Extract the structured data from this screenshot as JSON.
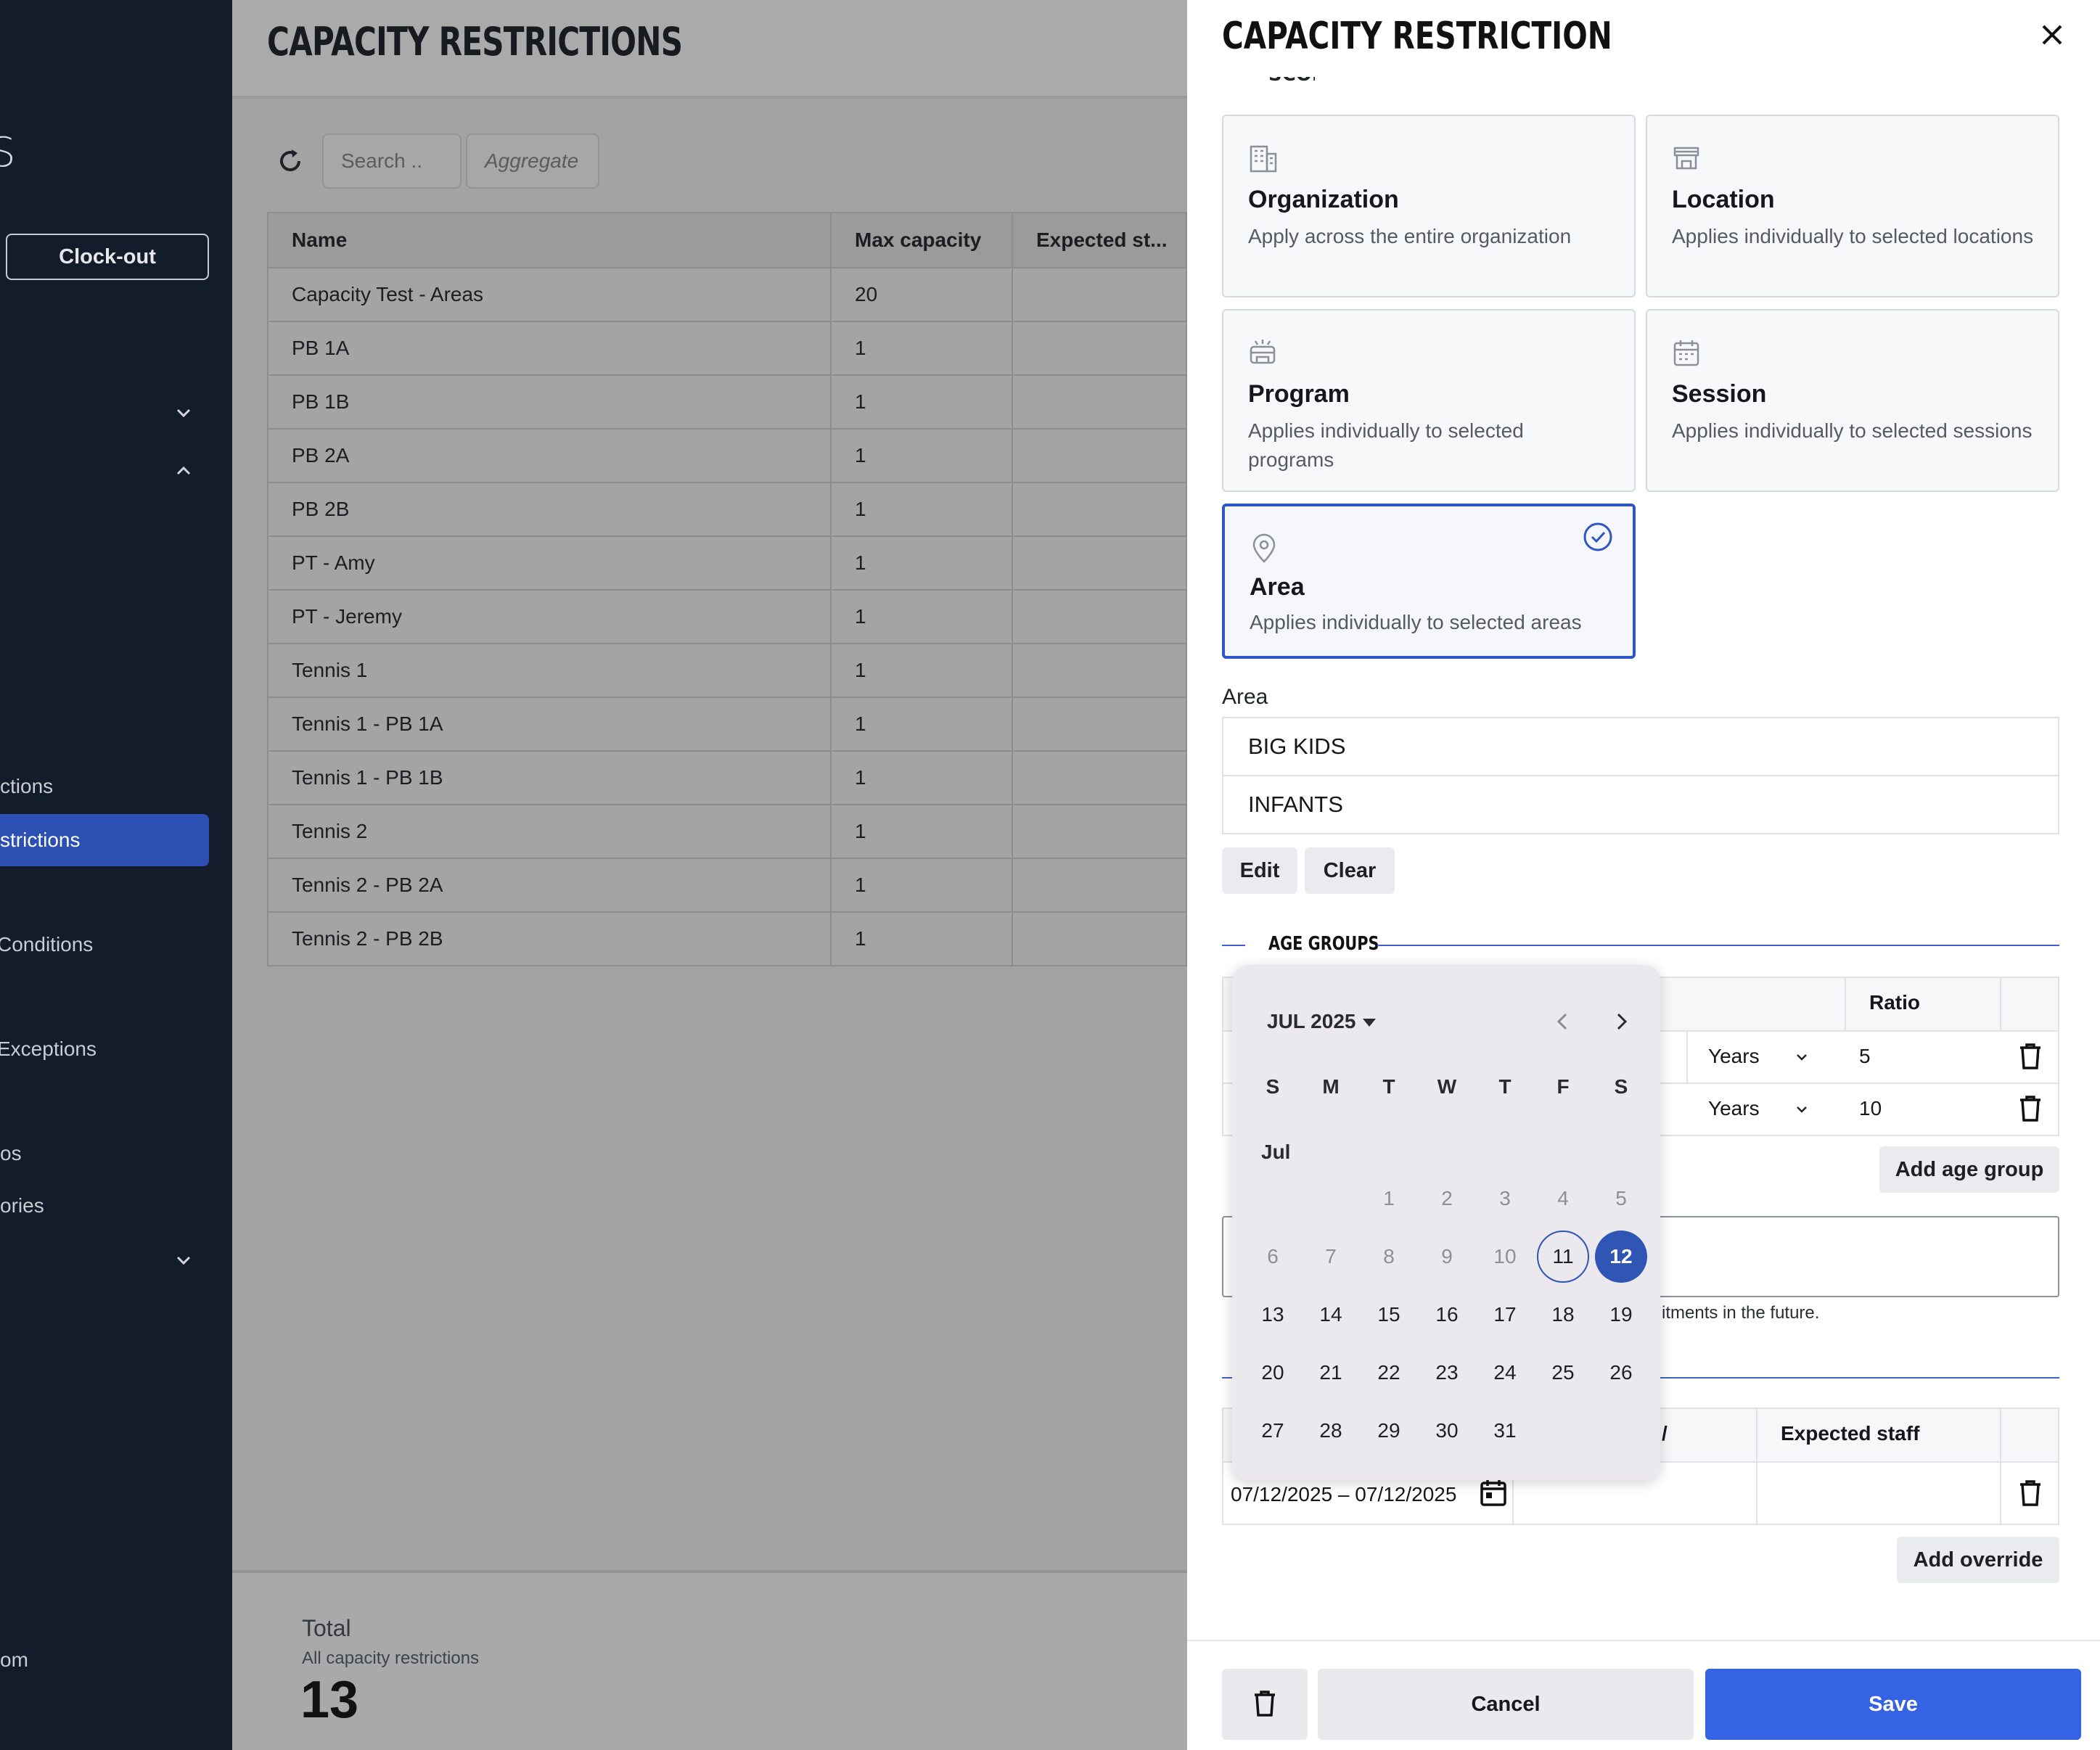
{
  "sidebar": {
    "logo_glyph": "S",
    "clock_out": "Clock-out",
    "items": [
      "ctions",
      "strictions",
      "Conditions",
      "Exceptions",
      "os",
      "ories",
      "om"
    ],
    "active_color": "#2c4fb3"
  },
  "main": {
    "title": "CAPACITY RESTRICTIONS",
    "search_placeholder": "Search ..",
    "aggregate_placeholder": "Aggregate",
    "columns": [
      "Name",
      "Max capacity",
      "Expected st..."
    ],
    "rows": [
      {
        "name": "Capacity Test - Areas",
        "max": "20"
      },
      {
        "name": "PB 1A",
        "max": "1"
      },
      {
        "name": "PB 1B",
        "max": "1"
      },
      {
        "name": "PB 2A",
        "max": "1"
      },
      {
        "name": "PB 2B",
        "max": "1"
      },
      {
        "name": "PT - Amy",
        "max": "1"
      },
      {
        "name": "PT - Jeremy",
        "max": "1"
      },
      {
        "name": "Tennis 1",
        "max": "1"
      },
      {
        "name": "Tennis 1 - PB 1A",
        "max": "1"
      },
      {
        "name": "Tennis 1 - PB 1B",
        "max": "1"
      },
      {
        "name": "Tennis 2",
        "max": "1"
      },
      {
        "name": "Tennis 2 - PB 2A",
        "max": "1"
      },
      {
        "name": "Tennis 2 - PB 2B",
        "max": "1"
      }
    ],
    "footer": {
      "label": "Total",
      "sub": "All capacity restrictions",
      "value": "13"
    }
  },
  "drawer": {
    "title": "CAPACITY RESTRICTION",
    "scope_heading": "SCOPE",
    "scopes": [
      {
        "title": "Organization",
        "desc": "Apply across the entire organization",
        "icon": "building-icon"
      },
      {
        "title": "Location",
        "desc": "Applies individually to selected locations",
        "icon": "store-icon"
      },
      {
        "title": "Program",
        "desc": "Applies individually to selected programs",
        "icon": "program-icon"
      },
      {
        "title": "Session",
        "desc": "Applies individually to selected sessions",
        "icon": "calendar-icon"
      },
      {
        "title": "Area",
        "desc": "Applies individually to selected areas",
        "icon": "map-pin-icon",
        "selected": true
      }
    ],
    "area": {
      "label": "Area",
      "values": [
        "BIG KIDS",
        "INFANTS"
      ],
      "edit": "Edit",
      "clear": "Clear"
    },
    "age_groups": {
      "heading": "AGE GROUPS",
      "ratio_header": "Ratio",
      "rows": [
        {
          "unit": "Years",
          "ratio": "5"
        },
        {
          "unit": "Years",
          "ratio": "10"
        }
      ],
      "add_label": "Add age group"
    },
    "cutoff_helper": "itments in the future.",
    "overrides": {
      "col_fragment": "/",
      "expected_staff_header": "Expected staff",
      "date_range": "07/12/2025 – 07/12/2025",
      "add_label": "Add override"
    },
    "actions": {
      "cancel": "Cancel",
      "save": "Save"
    },
    "accent": "#3563e3"
  },
  "calendar": {
    "month_label": "JUL 2025",
    "sub_label": "Jul",
    "weekdays": [
      "S",
      "M",
      "T",
      "W",
      "T",
      "F",
      "S"
    ],
    "weeks": [
      [
        "",
        "",
        "1",
        "2",
        "3",
        "4",
        "5"
      ],
      [
        "6",
        "7",
        "8",
        "9",
        "10",
        "11",
        "12"
      ],
      [
        "13",
        "14",
        "15",
        "16",
        "17",
        "18",
        "19"
      ],
      [
        "20",
        "21",
        "22",
        "23",
        "24",
        "25",
        "26"
      ],
      [
        "27",
        "28",
        "29",
        "30",
        "31",
        "",
        ""
      ]
    ],
    "disabled_through": 10,
    "today": "11",
    "selected": "12",
    "selected_color": "#2f56b4"
  }
}
